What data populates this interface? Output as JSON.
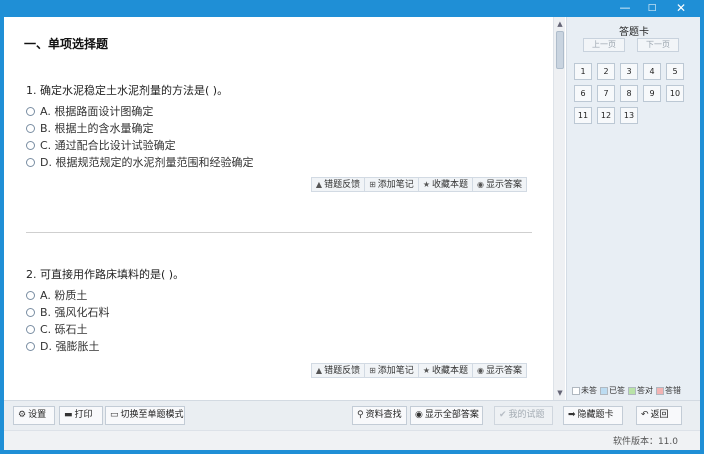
{
  "window": {
    "minimize": "—",
    "maximize": "□",
    "close": "✕",
    "accent": "#1f8fd6"
  },
  "main": {
    "section_title": "一、单项选择题",
    "questions": [
      {
        "stem": "1. 确定水泥稳定土水泥剂量的方法是(    )。",
        "options": [
          "A. 根据路面设计图确定",
          "B. 根据土的含水量确定",
          "C. 通过配合比设计试验确定",
          "D. 根据规范规定的水泥剂量范围和经验确定"
        ]
      },
      {
        "stem": "2. 可直接用作路床填料的是(    )。",
        "options": [
          "A. 粉质土",
          "B. 强风化石料",
          "C. 砾石土",
          "D. 强膨胀土"
        ]
      }
    ],
    "actions": {
      "report": "错题反馈",
      "note": "添加笔记",
      "favorite": "收藏本题",
      "show_answer": "显示答案"
    }
  },
  "card": {
    "title": "答题卡",
    "prev": "上一页",
    "next": "下一页",
    "numbers": [
      "1",
      "2",
      "3",
      "4",
      "5",
      "6",
      "7",
      "8",
      "9",
      "10",
      "11",
      "12",
      "13"
    ],
    "legend": [
      {
        "label": "未答",
        "color": "#ffffff"
      },
      {
        "label": "已答",
        "color": "#bcdcf2"
      },
      {
        "label": "答对",
        "color": "#b9e3a8"
      },
      {
        "label": "答错",
        "color": "#f3b3b3"
      }
    ]
  },
  "toolbar": {
    "settings": "设置",
    "print": "打印",
    "single_mode": "切换至单题模式",
    "reference": "资料查找",
    "show_all": "显示全部答案",
    "submit": "我的试题",
    "hide_card": "隐藏题卡",
    "back": "返回"
  },
  "status": {
    "version": "软件版本：11.0"
  }
}
